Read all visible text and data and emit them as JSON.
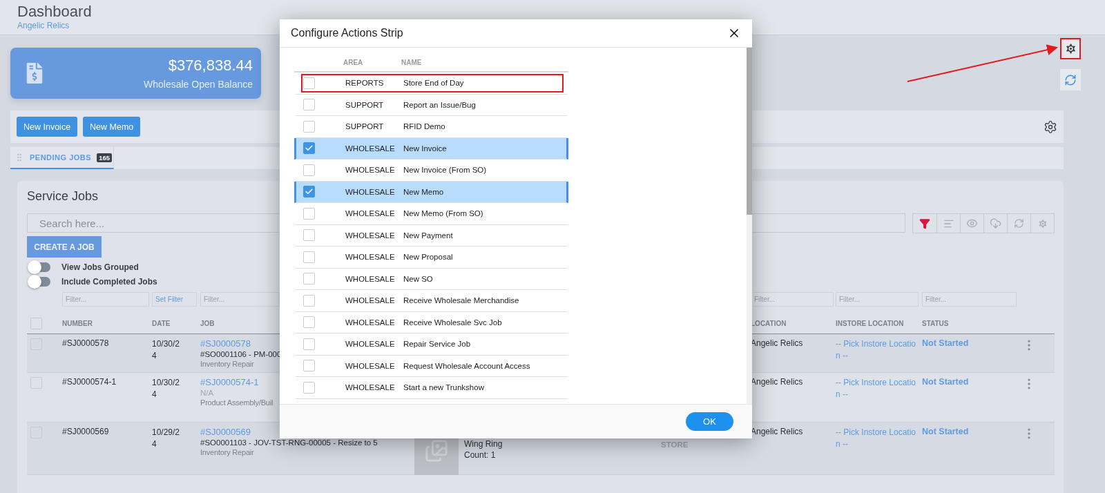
{
  "header": {
    "title": "Dashboard",
    "subtitle": "Angelic Relics"
  },
  "balance_card": {
    "amount": "$376,838.44",
    "label": "Wholesale Open Balance"
  },
  "actions_strip": {
    "buttons": [
      "New Invoice",
      "New Memo"
    ]
  },
  "side_buttons": [
    {
      "kind": "settings",
      "highlighted": true
    },
    {
      "kind": "refresh",
      "highlighted": false
    }
  ],
  "tabs": [
    {
      "label": "PENDING JOBS",
      "badge": "165",
      "selected": true
    }
  ],
  "service_jobs": {
    "title": "Service Jobs",
    "search": {
      "placeholder": "Search here..."
    },
    "filter_active": true,
    "create_button": "CREATE A JOB",
    "toggles": [
      {
        "label": "View Jobs Grouped",
        "on": false
      },
      {
        "label": "Include Completed Jobs",
        "on": false
      }
    ],
    "filters_left": [
      {
        "kind": "input",
        "placeholder": "Filter..."
      },
      {
        "kind": "link",
        "label": "Set Filter"
      },
      {
        "kind": "input",
        "placeholder": "Filter..."
      }
    ],
    "filters_right": [
      {
        "kind": "input",
        "placeholder": "Filter..."
      },
      {
        "kind": "input",
        "placeholder": "Filter..."
      },
      {
        "kind": "input",
        "placeholder": "Filter..."
      }
    ],
    "select_all_checked": false,
    "columns_left": [
      "NUMBER",
      "DATE",
      "JOB"
    ],
    "columns_right": [
      "LOCATION",
      "INSTORE LOCATION",
      "STATUS"
    ],
    "rows": [
      {
        "checked": false,
        "number": "#SJ0000578",
        "date": "10/30/24",
        "job_link": "#SJ0000578",
        "job_detail": "#SO0001106 - PM-000",
        "detail_muted": false,
        "job_type": "Inventory Repair",
        "location": "Angelic Relics",
        "instore_location": "-- Pick Instore Location --",
        "status": "Not Started"
      },
      {
        "checked": false,
        "number": "#SJ0000574-1",
        "date": "10/30/24",
        "job_link": "#SJ0000574-1",
        "job_detail": "N/A",
        "detail_muted": true,
        "job_type": "Product Assembly/Buil",
        "location": "Angelic Relics",
        "instore_location": "-- Pick Instore Location --",
        "status": "Not Started"
      },
      {
        "checked": false,
        "number": "#SJ0000569",
        "date": "10/29/24",
        "job_link": "#SJ0000569",
        "job_detail": "#SO0001103 - JOV-TST-RNG-00005 - Resize to 5",
        "detail_muted": false,
        "job_type": "Inventory Repair",
        "item": {
          "kind": "picture",
          "lines": [
            "Wing Ring",
            "Count: 1"
          ]
        },
        "store": "STORE",
        "location": "Angelic Relics",
        "instore_location": "-- Pick Instore Location --",
        "status": "Not Started"
      }
    ]
  },
  "dialog": {
    "title": "Configure Actions Strip",
    "columns": [
      "AREA",
      "NAME"
    ],
    "items": [
      {
        "area": "REPORTS",
        "name": "Store End of Day",
        "checked": false,
        "highlighted": true
      },
      {
        "area": "SUPPORT",
        "name": "Report an Issue/Bug",
        "checked": false,
        "highlighted": false
      },
      {
        "area": "SUPPORT",
        "name": "RFID Demo",
        "checked": false,
        "highlighted": false
      },
      {
        "area": "WHOLESALE",
        "name": "New Invoice",
        "checked": true,
        "highlighted": false
      },
      {
        "area": "WHOLESALE",
        "name": "New Invoice (From SO)",
        "checked": false,
        "highlighted": false
      },
      {
        "area": "WHOLESALE",
        "name": "New Memo",
        "checked": true,
        "highlighted": false
      },
      {
        "area": "WHOLESALE",
        "name": "New Memo (From SO)",
        "checked": false,
        "highlighted": false
      },
      {
        "area": "WHOLESALE",
        "name": "New Payment",
        "checked": false,
        "highlighted": false
      },
      {
        "area": "WHOLESALE",
        "name": "New Proposal",
        "checked": false,
        "highlighted": false
      },
      {
        "area": "WHOLESALE",
        "name": "New SO",
        "checked": false,
        "highlighted": false
      },
      {
        "area": "WHOLESALE",
        "name": "Receive Wholesale Merchandise",
        "checked": false,
        "highlighted": false
      },
      {
        "area": "WHOLESALE",
        "name": "Receive Wholesale Svc Job",
        "checked": false,
        "highlighted": false
      },
      {
        "area": "WHOLESALE",
        "name": "Repair Service Job",
        "checked": false,
        "highlighted": false
      },
      {
        "area": "WHOLESALE",
        "name": "Request Wholesale Account Access",
        "checked": false,
        "highlighted": false
      },
      {
        "area": "WHOLESALE",
        "name": "Start a new Trunkshow",
        "checked": false,
        "highlighted": false
      }
    ],
    "ok_button": "OK"
  }
}
